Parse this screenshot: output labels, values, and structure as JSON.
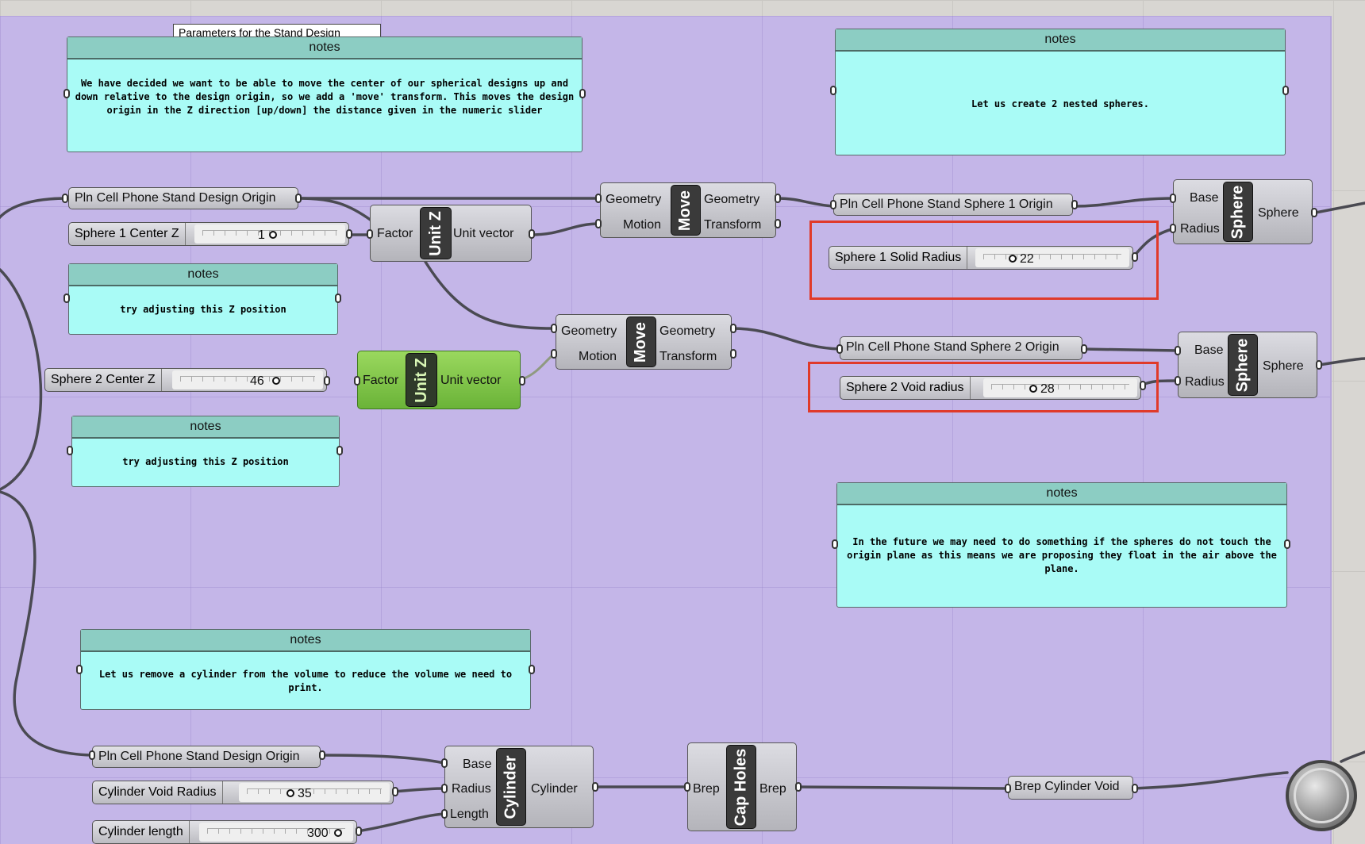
{
  "top_tab": "Parameters for the Stand Design",
  "notes": [
    {
      "title": "notes",
      "body": "We have decided we want to be able to move the center of our spherical designs up and down relative to the design origin, so we add a 'move' transform. This moves the design origin in the Z direction [up/down] the distance given in the numeric slider"
    },
    {
      "title": "notes",
      "body": "Let us create 2 nested spheres."
    },
    {
      "title": "notes",
      "body": "try adjusting this Z position"
    },
    {
      "title": "notes",
      "body": "try adjusting this Z position"
    },
    {
      "title": "notes",
      "body": "In the future we may need to do something if the spheres do not touch the origin plane as this means we are proposing they float in the air above the plane."
    },
    {
      "title": "notes",
      "body": "Let us remove a cylinder from the volume to reduce the volume we need to print."
    }
  ],
  "params": {
    "pln_origin_1": "Pln Cell Phone Stand Design Origin",
    "pln_sphere1": "Pln Cell Phone Stand Sphere 1 Origin",
    "pln_sphere2": "Pln Cell Phone Stand Sphere 2 Origin",
    "pln_origin_2": "Pln Cell Phone Stand Design Origin",
    "brep_void": "Brep Cylinder Void"
  },
  "sliders": {
    "sphere1_z": {
      "name": "Sphere 1 Center Z",
      "value": "1"
    },
    "sphere2_z": {
      "name": "Sphere 2 Center Z",
      "value": "46"
    },
    "sphere1_radius": {
      "name": "Sphere 1 Solid Radius",
      "value": "22"
    },
    "sphere2_radius": {
      "name": "Sphere 2 Void radius",
      "value": "28"
    },
    "cyl_radius": {
      "name": "Cylinder Void  Radius",
      "value": "35"
    },
    "cyl_length": {
      "name": "Cylinder length",
      "value": "300"
    }
  },
  "components": {
    "unitz1": {
      "core": "Unit Z",
      "in": "Factor",
      "out": "Unit vector"
    },
    "unitz2": {
      "core": "Unit Z",
      "in": "Factor",
      "out": "Unit vector"
    },
    "move1": {
      "core": "Move",
      "in1": "Geometry",
      "in2": "Motion",
      "out1": "Geometry",
      "out2": "Transform"
    },
    "move2": {
      "core": "Move",
      "in1": "Geometry",
      "in2": "Motion",
      "out1": "Geometry",
      "out2": "Transform"
    },
    "sphere1": {
      "core": "Sphere",
      "in1": "Base",
      "in2": "Radius",
      "out": "Sphere"
    },
    "sphere2": {
      "core": "Sphere",
      "in1": "Base",
      "in2": "Radius",
      "out": "Sphere"
    },
    "cylinder": {
      "core": "Cylinder",
      "in1": "Base",
      "in2": "Radius",
      "in3": "Length",
      "out": "Cylinder"
    },
    "capholes": {
      "core": "Cap Holes",
      "in": "Brep",
      "out": "Brep"
    }
  },
  "colors": {
    "group_bg": "#c4b6e8",
    "note_bg": "#a9fbf6",
    "note_header": "#8ccdc3",
    "highlight": "#e03a2a",
    "selected_component": "#7dc142"
  }
}
